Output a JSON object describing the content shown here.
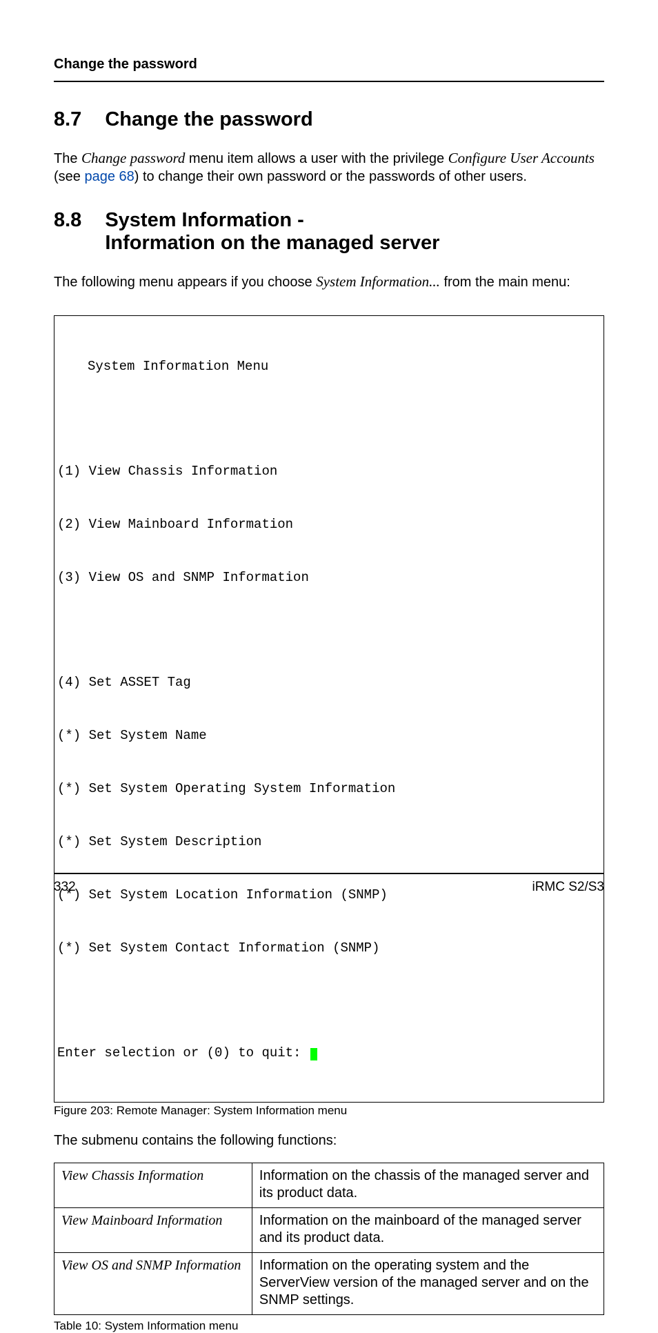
{
  "running_header": "Change the password",
  "section_8_7": {
    "number": "8.7",
    "title": "Change the password",
    "paragraph_parts": {
      "p1": "The ",
      "p2_italic": "Change password",
      "p3": " menu item allows a user with the privilege ",
      "p4_italic": "Configure User Accounts",
      "p5": " (see ",
      "p6_link": "page 68",
      "p7": ") to change their own password or the passwords of other users."
    }
  },
  "section_8_8": {
    "number": "8.8",
    "title_line1": "System Information -",
    "title_line2": "Information on the managed server",
    "paragraph_parts": {
      "p1": "The following menu appears if you choose ",
      "p2_italic": "System Information...",
      "p3": " from the main menu:"
    }
  },
  "code": {
    "title": "System Information Menu",
    "items": [
      "(1) View Chassis Information",
      "(2) View Mainboard Information",
      "(3) View OS and SNMP Information"
    ],
    "items2": [
      "(4) Set ASSET Tag",
      "(*) Set System Name",
      "(*) Set System Operating System Information",
      "(*) Set System Description",
      "(*) Set System Location Information (SNMP)",
      "(*) Set System Contact Information (SNMP)"
    ],
    "prompt": "Enter selection or (0) to quit: "
  },
  "figure_caption": "Figure 203: Remote Manager: System Information menu",
  "after_code_text": "The submenu contains the following functions:",
  "table": {
    "rows": [
      {
        "left": "View Chassis Information",
        "right": "Information on the chassis of the managed server and its product data."
      },
      {
        "left": "View Mainboard Information",
        "right": "Information on the mainboard of the managed server and its product data."
      },
      {
        "left": "View OS and SNMP Information",
        "right": "Information on the operating system and the ServerView version of the managed server and on the SNMP settings."
      }
    ]
  },
  "table_caption": "Table 10: System Information menu",
  "footer": {
    "page": "332",
    "doc": "iRMC S2/S3"
  }
}
